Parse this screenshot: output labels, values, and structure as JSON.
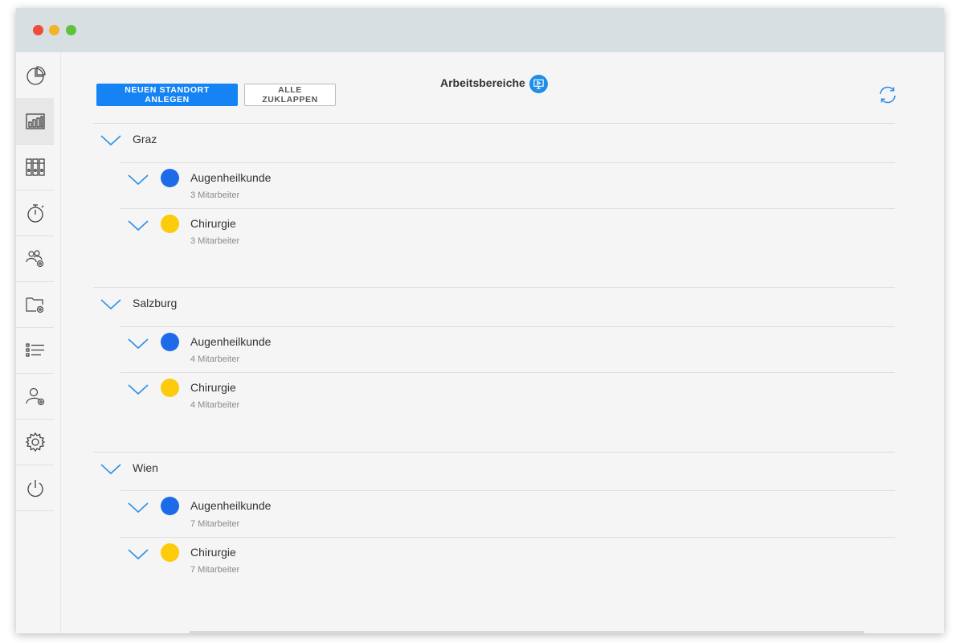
{
  "header": {
    "title": "Arbeitsbereiche",
    "primary_button": "NEUEN STANDORT ANLEGEN",
    "secondary_button": "ALLE ZUKLAPPEN"
  },
  "colors": {
    "accent": "#1683f5",
    "blue_dot": "#1e6bea",
    "yellow_dot": "#fccb0a"
  },
  "sidebar": {
    "items": [
      {
        "icon": "pie-chart-icon"
      },
      {
        "icon": "bar-chart-icon",
        "active": true
      },
      {
        "icon": "binders-icon"
      },
      {
        "icon": "stopwatch-icon"
      },
      {
        "icon": "group-settings-icon"
      },
      {
        "icon": "folder-settings-icon"
      },
      {
        "icon": "list-icon"
      },
      {
        "icon": "user-settings-icon"
      },
      {
        "icon": "gear-icon"
      },
      {
        "icon": "power-icon"
      }
    ]
  },
  "locations": [
    {
      "name": "Graz",
      "areas": [
        {
          "name": "Augenheilkunde",
          "count": "3 Mitarbeiter",
          "color": "blue"
        },
        {
          "name": "Chirurgie",
          "count": "3 Mitarbeiter",
          "color": "yellow"
        }
      ]
    },
    {
      "name": "Salzburg",
      "areas": [
        {
          "name": "Augenheilkunde",
          "count": "4 Mitarbeiter",
          "color": "blue"
        },
        {
          "name": "Chirurgie",
          "count": "4 Mitarbeiter",
          "color": "yellow"
        }
      ]
    },
    {
      "name": "Wien",
      "areas": [
        {
          "name": "Augenheilkunde",
          "count": "7 Mitarbeiter",
          "color": "blue"
        },
        {
          "name": "Chirurgie",
          "count": "7 Mitarbeiter",
          "color": "yellow"
        }
      ]
    }
  ]
}
